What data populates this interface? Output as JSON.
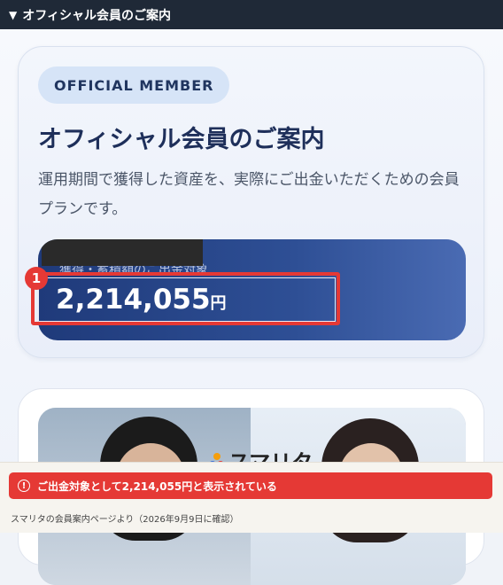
{
  "header": {
    "title": "オフィシャル会員のご案内"
  },
  "card": {
    "badge": "OFFICIAL MEMBER",
    "title": "オフィシャル会員のご案内",
    "description": "運用期間で獲得した資産を、実際にご出金いただくための会員プランです。",
    "amount_label": "獲得・蓄積額のご出金対象",
    "amount_value": "2,214,055",
    "amount_unit": "円",
    "marker": "1"
  },
  "promo": {
    "logo_text": "スマリタ"
  },
  "alert": {
    "text": "ご出金対象として2,214,055円と表示されている"
  },
  "caption": {
    "text": "スマリタの会員案内ページより（2026年9月9日に確認）"
  },
  "colors": {
    "accent_red": "#e53935",
    "navy": "#1e2f5a",
    "topbar": "#1f2937"
  }
}
